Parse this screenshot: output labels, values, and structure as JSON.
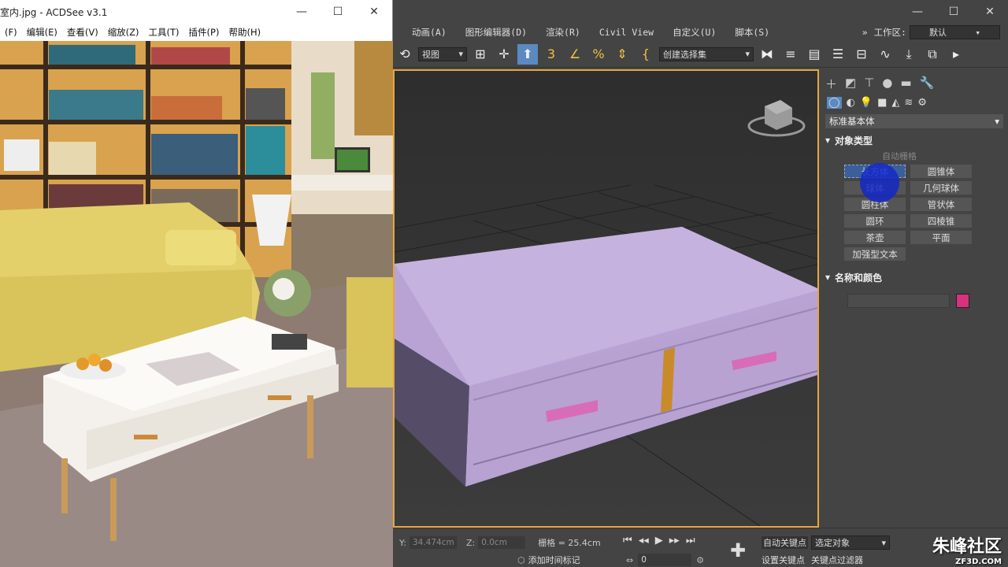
{
  "acdsee": {
    "title": "室内.jpg - ACDSee v3.1",
    "menu": [
      "(F)",
      "编辑(E)",
      "查看(V)",
      "缩放(Z)",
      "工具(T)",
      "插件(P)",
      "帮助(H)"
    ],
    "min": "—",
    "max": "☐",
    "close": "✕"
  },
  "max3d": {
    "min": "—",
    "max": "☐",
    "close": "✕",
    "menu": [
      "动画(A)",
      "图形编辑器(D)",
      "渲染(R)",
      "Civil View",
      "自定义(U)",
      "脚本(S)"
    ],
    "workspace_label": "工作区:",
    "workspace_value": "默认",
    "view_dropdown": "视图",
    "selection_set": "创建选择集",
    "category": "标准基本体",
    "rollout_object_type": "对象类型",
    "autogrid": "自动栅格",
    "primitives": [
      "长方体",
      "圆锥体",
      "球体",
      "几何球体",
      "圆柱体",
      "管状体",
      "圆环",
      "四棱锥",
      "茶壶",
      "平面",
      "加强型文本"
    ],
    "rollout_name_color": "名称和颜色",
    "object_color": "#d8317e",
    "status": {
      "y_label": "Y:",
      "y_value": "34.474cm",
      "z_label": "Z:",
      "z_value": "0.0cm",
      "grid": "栅格 = 25.4cm",
      "auto_key": "自动关键点",
      "selected": "选定对象",
      "set_key": "设置关键点",
      "key_filter": "关键点过滤器",
      "add_time_tag": "添加时间标记",
      "frame": "0"
    }
  },
  "watermark": {
    "text": "朱峰社区",
    "sub": "ZF3D.COM"
  }
}
